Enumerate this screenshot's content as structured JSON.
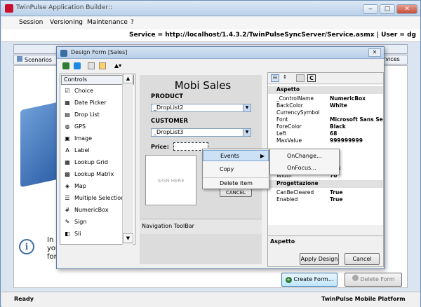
{
  "window": {
    "title": "TwinPulse Application Builder::"
  },
  "menu": [
    "Session",
    "Versioning",
    "Maintenance",
    "?"
  ],
  "service": {
    "text": "Service = http://localhost/1.4.3.2/TwinPulseSyncServer/Service.asmx",
    "user": "User = dg"
  },
  "tabs": {
    "scenarios": "Scenarios",
    "services": "rvices"
  },
  "info_text": [
    "In",
    "you",
    "for"
  ],
  "dialog": {
    "title": "Design Form [Sales]",
    "controls_header": "Controls",
    "controls": [
      {
        "label": "Choice",
        "icon": "checkbox-icon"
      },
      {
        "label": "Date Picker",
        "icon": "calendar-icon"
      },
      {
        "label": "Drop List",
        "icon": "droplist-icon"
      },
      {
        "label": "GPS",
        "icon": "globe-icon"
      },
      {
        "label": "Image",
        "icon": "image-icon"
      },
      {
        "label": "Label",
        "icon": "label-icon"
      },
      {
        "label": "Lookup Grid",
        "icon": "grid-icon"
      },
      {
        "label": "Lookup Matrix",
        "icon": "matrix-icon"
      },
      {
        "label": "Map",
        "icon": "map-icon"
      },
      {
        "label": "Multiple Selection",
        "icon": "multiselect-icon"
      },
      {
        "label": "NumericBox",
        "icon": "numeric-icon"
      },
      {
        "label": "Sign",
        "icon": "pen-icon"
      },
      {
        "label": "Sli",
        "icon": "slider-icon"
      }
    ],
    "form": {
      "title": "Mobi Sales",
      "product_label": "PRODUCT",
      "product_value": "_DropList2",
      "customer_label": "CUSTOMER",
      "customer_value": "_DropList3",
      "price_label": "Price:",
      "sign_text": "SIGN HERE",
      "cancel_label": "CANCEL",
      "toolbar_label": "Navigation ToolBar"
    },
    "props": {
      "section1": "Aspetto",
      "rows": [
        {
          "k": "_ControlName",
          "v": "NumericBox"
        },
        {
          "k": "BackColor",
          "v": "White"
        },
        {
          "k": "CurrencySymbol",
          "v": ""
        },
        {
          "k": "Font",
          "v": "Microsoft Sans Se"
        },
        {
          "k": "ForeColor",
          "v": "Black"
        },
        {
          "k": "Left",
          "v": "68"
        },
        {
          "k": "MaxValue",
          "v": "999999999"
        },
        {
          "k": "",
          "v": ""
        },
        {
          "k": "",
          "v": "r"
        },
        {
          "k": "",
          "v": ""
        },
        {
          "k": "Top",
          "v": "133"
        },
        {
          "k": "Width",
          "v": "70"
        }
      ],
      "section2": "Progettazione",
      "rows2": [
        {
          "k": "CanBeCleared",
          "v": "True"
        },
        {
          "k": "Enabled",
          "v": "True"
        }
      ],
      "description": "Aspetto"
    },
    "apply_label": "Apply Design",
    "cancel_label": "Cancel"
  },
  "context_menu": {
    "events": "Events",
    "copy": "Copy",
    "delete": "Delete item"
  },
  "submenu": {
    "onchange": "OnChange...",
    "onfocus": "OnFocus..."
  },
  "bottom": {
    "create": "Create Form...",
    "delete": "Delete Form"
  },
  "status": {
    "left": "Ready",
    "right": "TwinPulse Mobile Platform"
  },
  "colors": {
    "accent": "#3a6ea5",
    "titlebar": "#b9d1ea"
  }
}
